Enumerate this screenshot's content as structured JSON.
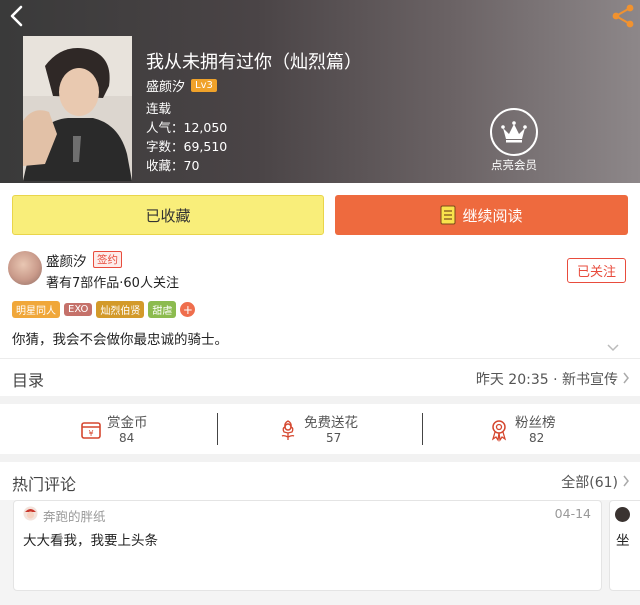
{
  "book": {
    "title": "我从未拥有过你（灿烈篇）",
    "author": "盛颜汐",
    "level": "Lv3",
    "status": "连载",
    "popularity": "人气：12,050",
    "word_count": "字数：69,510",
    "favorites": "收藏：70"
  },
  "vip": {
    "label": "点亮会员"
  },
  "actions": {
    "collected_label": "已收藏",
    "continue_label": "继续阅读"
  },
  "author_card": {
    "name": "盛颜汐",
    "sign_badge": "签约",
    "stats": "著有7部作品·60人关注",
    "follow_label": "已关注",
    "tags": [
      {
        "text": "明星同人",
        "color": "#f0a73a"
      },
      {
        "text": "EXO",
        "color": "#c5716a"
      },
      {
        "text": "灿烈伯贤",
        "color": "#d39a2a"
      },
      {
        "text": "甜虐",
        "color": "#8cbb4f"
      }
    ],
    "tag_add": "+",
    "intro": "你猜，我会不会做你最忠诚的骑士。"
  },
  "toc": {
    "label": "目录",
    "latest": "昨天 20:35 · 新书宣传"
  },
  "stats": {
    "reward": {
      "label": "赏金币",
      "count": "84",
      "icon": "gold-coin-icon"
    },
    "flowers": {
      "label": "免费送花",
      "count": "57",
      "icon": "flower-icon"
    },
    "fans": {
      "label": "粉丝榜",
      "count": "82",
      "icon": "medal-icon"
    }
  },
  "comments": {
    "title": "热门评论",
    "all_label": "全部(61)",
    "items": [
      {
        "user": "奔跑的胖纸",
        "date": "04-14",
        "text": "大大看我，我要上头条"
      },
      {
        "user": "",
        "date": "",
        "text": "坐"
      }
    ]
  },
  "colors": {
    "accent": "#ee6a3e",
    "collect_bg": "#f9ee7a",
    "red": "#e84c3d"
  }
}
